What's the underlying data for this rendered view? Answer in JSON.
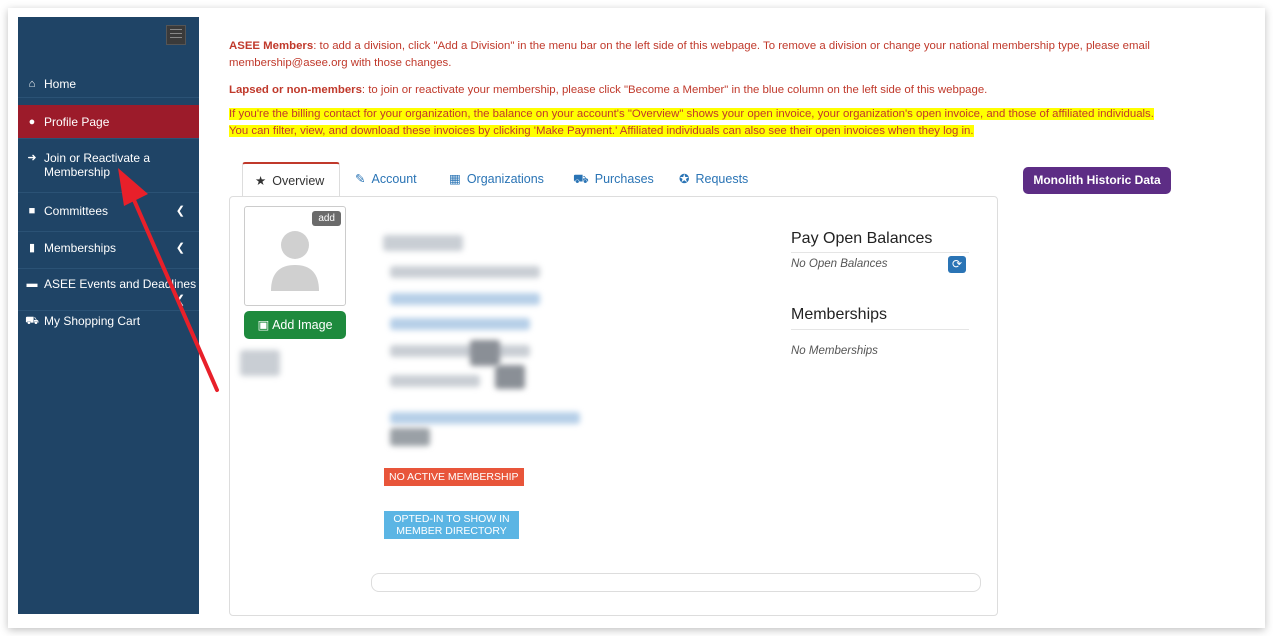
{
  "sidebar": {
    "items": [
      {
        "icon": "home-icon",
        "glyph": "⌂",
        "label": "Home"
      },
      {
        "icon": "user-icon",
        "glyph": "●",
        "label": "Profile Page"
      },
      {
        "icon": "arrow-circle-icon",
        "glyph": "➜",
        "label": "Join or Reactivate a Membership"
      },
      {
        "icon": "briefcase-icon",
        "glyph": "■",
        "label": "Committees"
      },
      {
        "icon": "bookmark-icon",
        "glyph": "▮",
        "label": "Memberships"
      },
      {
        "icon": "ticket-icon",
        "glyph": "▬",
        "label": "ASEE Events and Deadlines"
      },
      {
        "icon": "cart-icon",
        "glyph": "⛟",
        "label": "My Shopping Cart"
      }
    ]
  },
  "notices": {
    "members_bold": "ASEE Members",
    "members_text": ": to add a division, click \"Add a Division\" in the menu bar on the left side of this webpage. To remove a division or change your national membership type, please email membership@asee.org with those changes.",
    "lapsed_bold": "Lapsed or non-members",
    "lapsed_text": ": to join or reactivate your membership, please click \"Become a Member\" in the blue column on the left side of this webpage.",
    "billing_line1": "If you're the billing contact for your organization, the balance on your account's \"Overview\" shows your open invoice, your organization's open invoice, and those of affiliated individuals.",
    "billing_line2": "You can filter, view, and download these invoices by clicking 'Make Payment.' Affiliated individuals can also see their open invoices when they log in."
  },
  "tabs": [
    {
      "icon": "star-icon",
      "glyph": "★",
      "label": "Overview"
    },
    {
      "icon": "edit-icon",
      "glyph": "✎",
      "label": "Account"
    },
    {
      "icon": "building-icon",
      "glyph": "▦",
      "label": "Organizations"
    },
    {
      "icon": "cart-icon",
      "glyph": "⛟",
      "label": "Purchases"
    },
    {
      "icon": "support-icon",
      "glyph": "✪",
      "label": "Requests"
    }
  ],
  "monolith_button": "Monolith Historic Data",
  "profile": {
    "add_badge": "add",
    "add_image_label": "Add Image",
    "status_badge": "NO ACTIVE MEMBERSHIP",
    "directory_badge_line1": "OPTED-IN TO SHOW IN",
    "directory_badge_line2": "MEMBER DIRECTORY"
  },
  "balances": {
    "title": "Pay Open Balances",
    "value": "No Open Balances"
  },
  "memberships": {
    "title": "Memberships",
    "value": "No Memberships"
  },
  "colors": {
    "sidebar": "#1f4466",
    "active_nav": "#9c1b2a",
    "notice_red": "#c0392b",
    "highlight": "#ffff00",
    "monolith": "#5d2d85",
    "add_image": "#1e8a3d"
  }
}
